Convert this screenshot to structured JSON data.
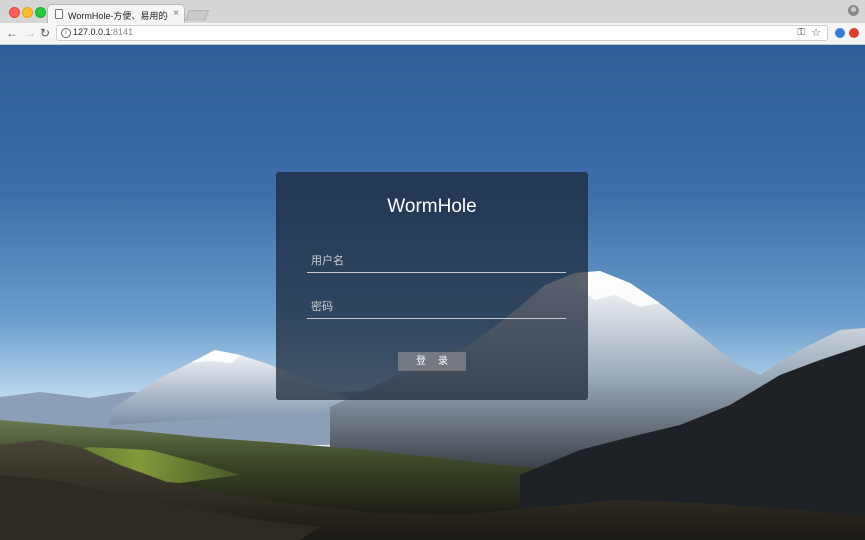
{
  "browser": {
    "tab_title": "WormHole-方便、易用的dubbo",
    "tab_close": "×",
    "url_host": "127.0.0.1",
    "url_port": ":8141",
    "icons": [
      "back-arrow-icon",
      "forward-arrow-icon",
      "reload-icon",
      "info-icon",
      "key-icon",
      "star-icon",
      "profile-icon"
    ]
  },
  "login": {
    "title": "WormHole",
    "username_placeholder": "用户名",
    "password_placeholder": "密码",
    "submit_label": "登录"
  },
  "colors": {
    "card_bg": "#1a2434",
    "sky_top": "#2e5c97",
    "button_bg": "#969696"
  }
}
